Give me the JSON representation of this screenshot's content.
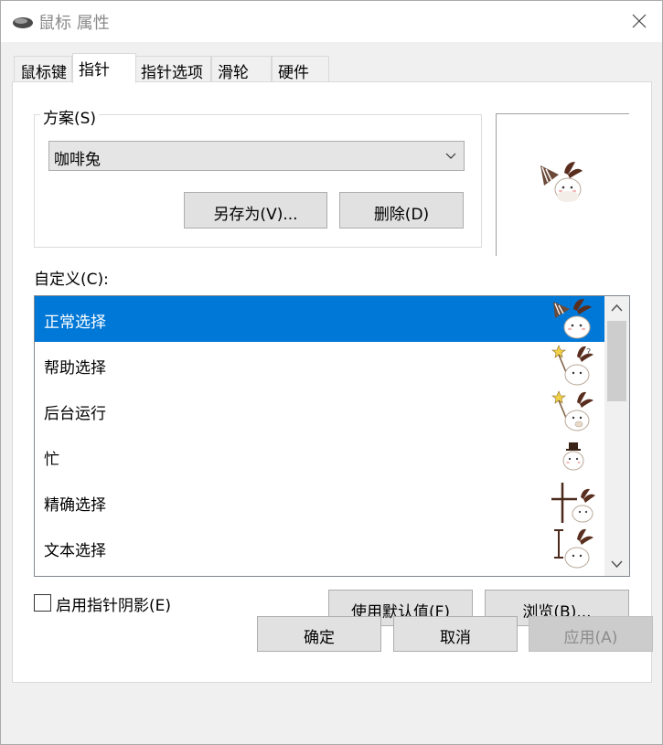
{
  "window": {
    "title": "鼠标 属性"
  },
  "tabs": [
    {
      "label": "鼠标键"
    },
    {
      "label": "指针"
    },
    {
      "label": "指针选项"
    },
    {
      "label": "滑轮"
    },
    {
      "label": "硬件"
    }
  ],
  "scheme": {
    "group_label": "方案(S)",
    "selected": "咖啡兔",
    "save_as_label": "另存为(V)...",
    "delete_label": "删除(D)"
  },
  "customize": {
    "label": "自定义(C):",
    "items": [
      {
        "label": "正常选择",
        "selected": true,
        "icon": "bunny-flag-cursor-icon"
      },
      {
        "label": "帮助选择",
        "selected": false,
        "icon": "bunny-star-help-cursor-icon"
      },
      {
        "label": "后台运行",
        "selected": false,
        "icon": "bunny-star-busy-cursor-icon"
      },
      {
        "label": "忙",
        "selected": false,
        "icon": "bunny-hat-busy-cursor-icon"
      },
      {
        "label": "精确选择",
        "selected": false,
        "icon": "bunny-crosshair-cursor-icon"
      },
      {
        "label": "文本选择",
        "selected": false,
        "icon": "bunny-ibeam-cursor-icon"
      }
    ]
  },
  "shadow": {
    "label": "启用指针阴影(E)",
    "checked": false
  },
  "buttons": {
    "use_default": "使用默认值(F)",
    "browse": "浏览(B)...",
    "ok": "确定",
    "cancel": "取消",
    "apply": "应用(A)"
  },
  "colors": {
    "selection": "#0078d7",
    "window_bg": "#f0f0f0"
  }
}
